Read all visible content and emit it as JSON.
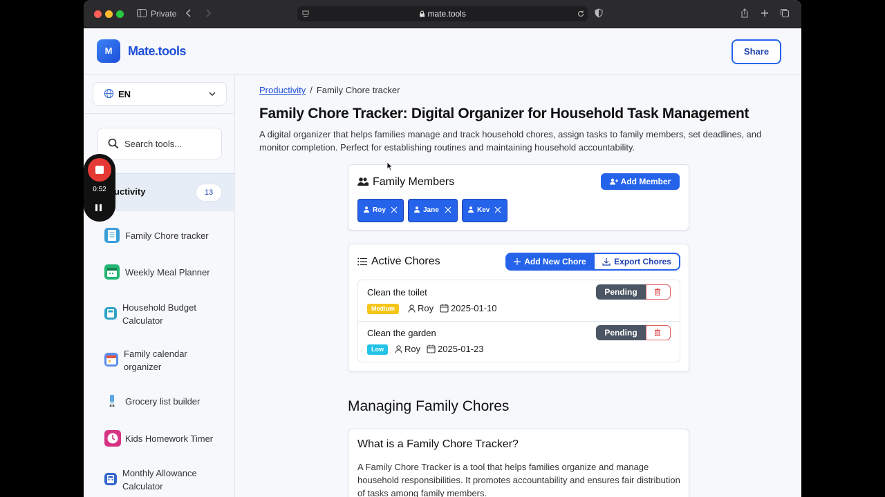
{
  "browser": {
    "mode_label": "Private",
    "url": "mate.tools"
  },
  "header": {
    "logo_letter": "M",
    "brand": "Mate.tools",
    "share_label": "Share"
  },
  "sidebar": {
    "language": "EN",
    "search_placeholder": "Search tools...",
    "category": {
      "label": "Productivity",
      "visible_label": "ductivity",
      "count": "13"
    },
    "tools": [
      {
        "name": "Family Chore tracker",
        "color": "#3b9fd8"
      },
      {
        "name": "Weekly Meal Planner",
        "color": "#22b573"
      },
      {
        "name": "Household Budget Calculator",
        "color": "#2ea3c7"
      },
      {
        "name": "Family calendar organizer",
        "color": "#5b8def"
      },
      {
        "name": "Grocery list builder",
        "color": "#5aa9e6"
      },
      {
        "name": "Kids Homework Timer",
        "color": "#d63384"
      },
      {
        "name": "Monthly Allowance Calculator",
        "color": "#3366cc"
      }
    ]
  },
  "recorder": {
    "time": "0:52"
  },
  "main": {
    "breadcrumb": {
      "parent": "Productivity",
      "separator": "/",
      "current": "Family Chore tracker"
    },
    "title": "Family Chore Tracker: Digital Organizer for Household Task Management",
    "description": "A digital organizer that helps families manage and track household chores, assign tasks to family members, set deadlines, and monitor completion. Perfect for establishing routines and maintaining household accountability.",
    "members_card": {
      "title": "Family Members",
      "add_label": "Add Member",
      "members": [
        "Roy",
        "Jane",
        "Kev"
      ]
    },
    "chores_card": {
      "title": "Active Chores",
      "add_label": "Add New Chore",
      "export_label": "Export Chores",
      "chores": [
        {
          "name": "Clean the toilet",
          "priority": "Medium",
          "priority_color": "#f5c518",
          "assignee": "Roy",
          "date": "2025-01-10",
          "status": "Pending"
        },
        {
          "name": "Clean the garden",
          "priority": "Low",
          "priority_color": "#22c3e6",
          "assignee": "Roy",
          "date": "2025-01-23",
          "status": "Pending"
        }
      ]
    },
    "section_title": "Managing Family Chores",
    "faq": {
      "question": "What is a Family Chore Tracker?",
      "answer": "A Family Chore Tracker is a tool that helps families organize and manage household responsibilities. It promotes accountability and ensures fair distribution of tasks among family members."
    }
  }
}
